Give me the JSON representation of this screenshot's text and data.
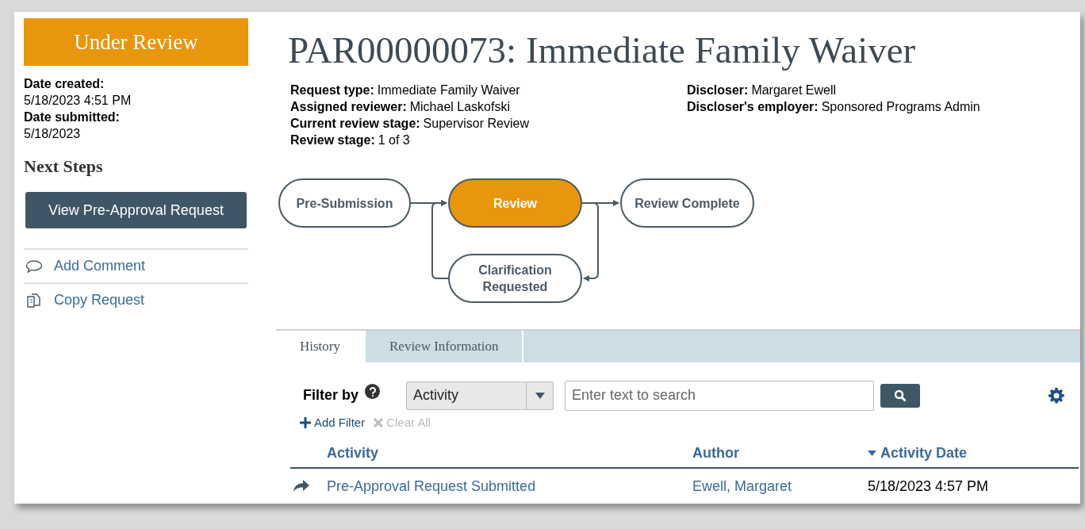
{
  "status": {
    "label": "Under Review"
  },
  "dates": [
    {
      "label": "Date created:",
      "value": "5/18/2023 4:51 PM"
    },
    {
      "label": "Date submitted:",
      "value": "5/18/2023"
    }
  ],
  "next_steps": {
    "title": "Next Steps",
    "primary_action": "View Pre-Approval Request",
    "actions": [
      {
        "kind": "comment",
        "label": "Add Comment"
      },
      {
        "kind": "copy",
        "label": "Copy Request"
      }
    ]
  },
  "title": "PAR00000073: Immediate Family Waiver",
  "details_left": [
    {
      "label": "Request type:",
      "value": "Immediate Family Waiver"
    },
    {
      "label": "Assigned reviewer:",
      "value": "Michael Laskofski"
    },
    {
      "label": "Current review stage:",
      "value": "Supervisor Review"
    },
    {
      "label": "Review stage:",
      "value": "1 of 3"
    }
  ],
  "details_right": [
    {
      "label": "Discloser:",
      "value": "Margaret Ewell"
    },
    {
      "label": "Discloser's employer:",
      "value": "Sponsored Programs Admin"
    }
  ],
  "workflow": [
    {
      "label": "Pre-Submission",
      "selected": false
    },
    {
      "label": "Review",
      "selected": true
    },
    {
      "label": "Review Complete",
      "selected": false
    },
    {
      "label": "Clarification Requested",
      "selected": false
    }
  ],
  "tabs": [
    {
      "label": "History",
      "selected": true
    },
    {
      "label": "Review Information",
      "selected": false
    }
  ],
  "filter": {
    "label": "Filter by",
    "dropdown": "Activity",
    "placeholder": "Enter text to search",
    "add_filter": "Add Filter",
    "clear_all": {
      "label": "Clear All",
      "disabled": true
    }
  },
  "table": {
    "columns": [
      {
        "label": "Activity",
        "sorted": false
      },
      {
        "label": "Author",
        "sorted": false
      },
      {
        "label": "Activity Date",
        "sorted": true
      }
    ],
    "rows": [
      {
        "activity": "Pre-Approval Request Submitted",
        "author": "Ewell, Margaret",
        "date": "5/18/2023 4:57 PM"
      }
    ]
  }
}
